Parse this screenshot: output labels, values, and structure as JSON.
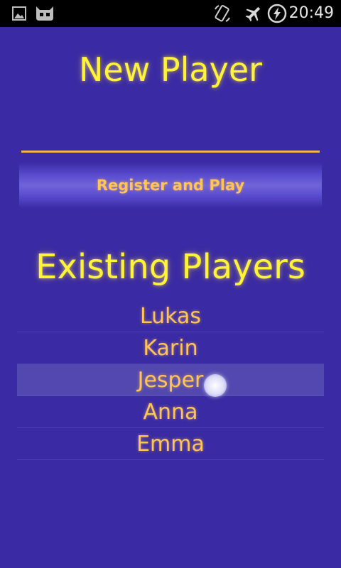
{
  "status_bar": {
    "time": "20:49",
    "icons": [
      "image-icon",
      "cyanogen-icon",
      "rotation-icon",
      "airplane-mode-icon",
      "battery-charging-icon"
    ]
  },
  "new_player": {
    "title": "New Player",
    "name_input_value": "",
    "register_label": "Register and Play"
  },
  "existing_players": {
    "title": "Existing Players",
    "players": [
      "Lukas",
      "Karin",
      "Jesper",
      "Anna",
      "Emma"
    ],
    "pressed_player": "Jesper"
  },
  "colors": {
    "background": "#3a2aa4",
    "title_yellow": "#fff33a",
    "label_orange": "#ffc35a",
    "input_underline": "#f2b24f",
    "pressed_row": "#5348b0"
  }
}
